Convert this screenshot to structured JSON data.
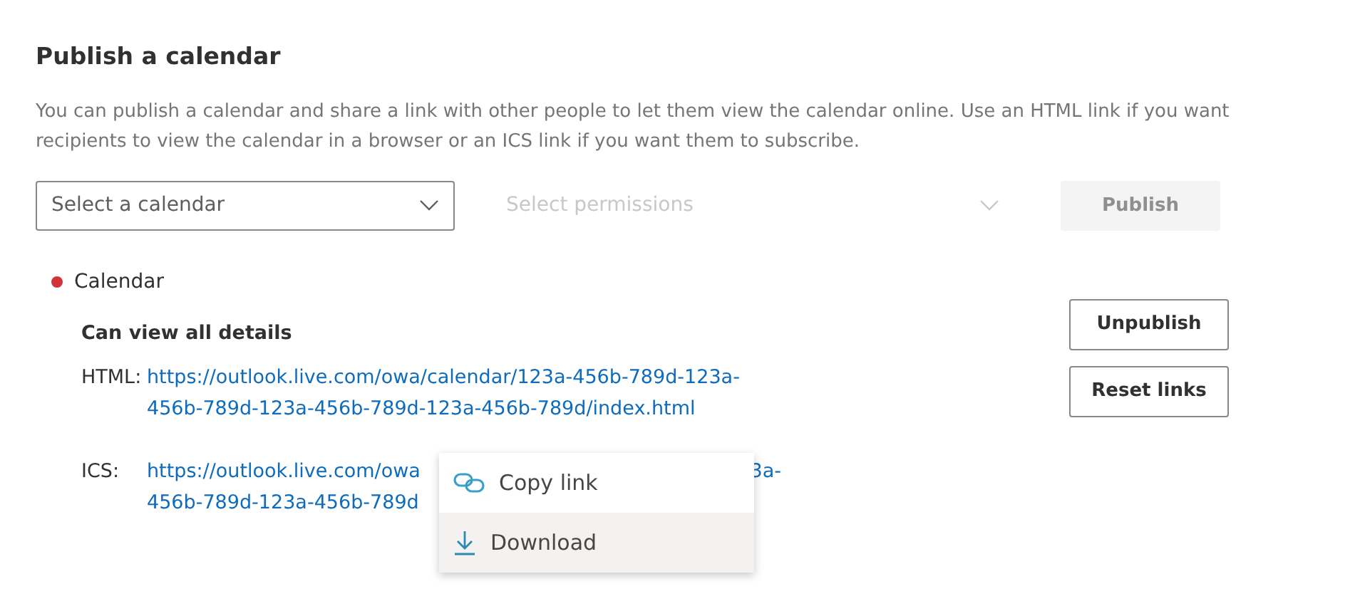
{
  "title": "Publish a calendar",
  "description": "You can publish a calendar and share a link with other people to let them view the calendar online. Use an HTML link if you want recipients to view the calendar in a browser or an ICS link if you want them to subscribe.",
  "calendar_select": {
    "placeholder": "Select a calendar",
    "disabled": false
  },
  "permissions_select": {
    "placeholder": "Select permissions",
    "disabled": true
  },
  "publish_button": {
    "label": "Publish",
    "disabled": true
  },
  "published": {
    "name": "Calendar",
    "color": "#d13438",
    "permission": "Can view all details",
    "links": [
      {
        "label": "HTML:",
        "lines": [
          {
            "start": "https://outlook.live.com/owa/calendar/123a-456b-789d-123a-"
          },
          {
            "start": "456b-789d-123a-456b-789d-123a-456b-789d/index.html"
          }
        ]
      },
      {
        "label": "ICS:",
        "lines": [
          {
            "start": "https://outlook.live.com/owa",
            "end": "3a-"
          },
          {
            "start": "456b-789d-123a-456b-789d"
          }
        ]
      }
    ],
    "buttons": [
      "Unpublish",
      "Reset links"
    ]
  },
  "context_menu": [
    {
      "kind": "copy",
      "label": "Copy link",
      "highlighted": false
    },
    {
      "kind": "download",
      "label": "Download",
      "highlighted": true
    }
  ]
}
